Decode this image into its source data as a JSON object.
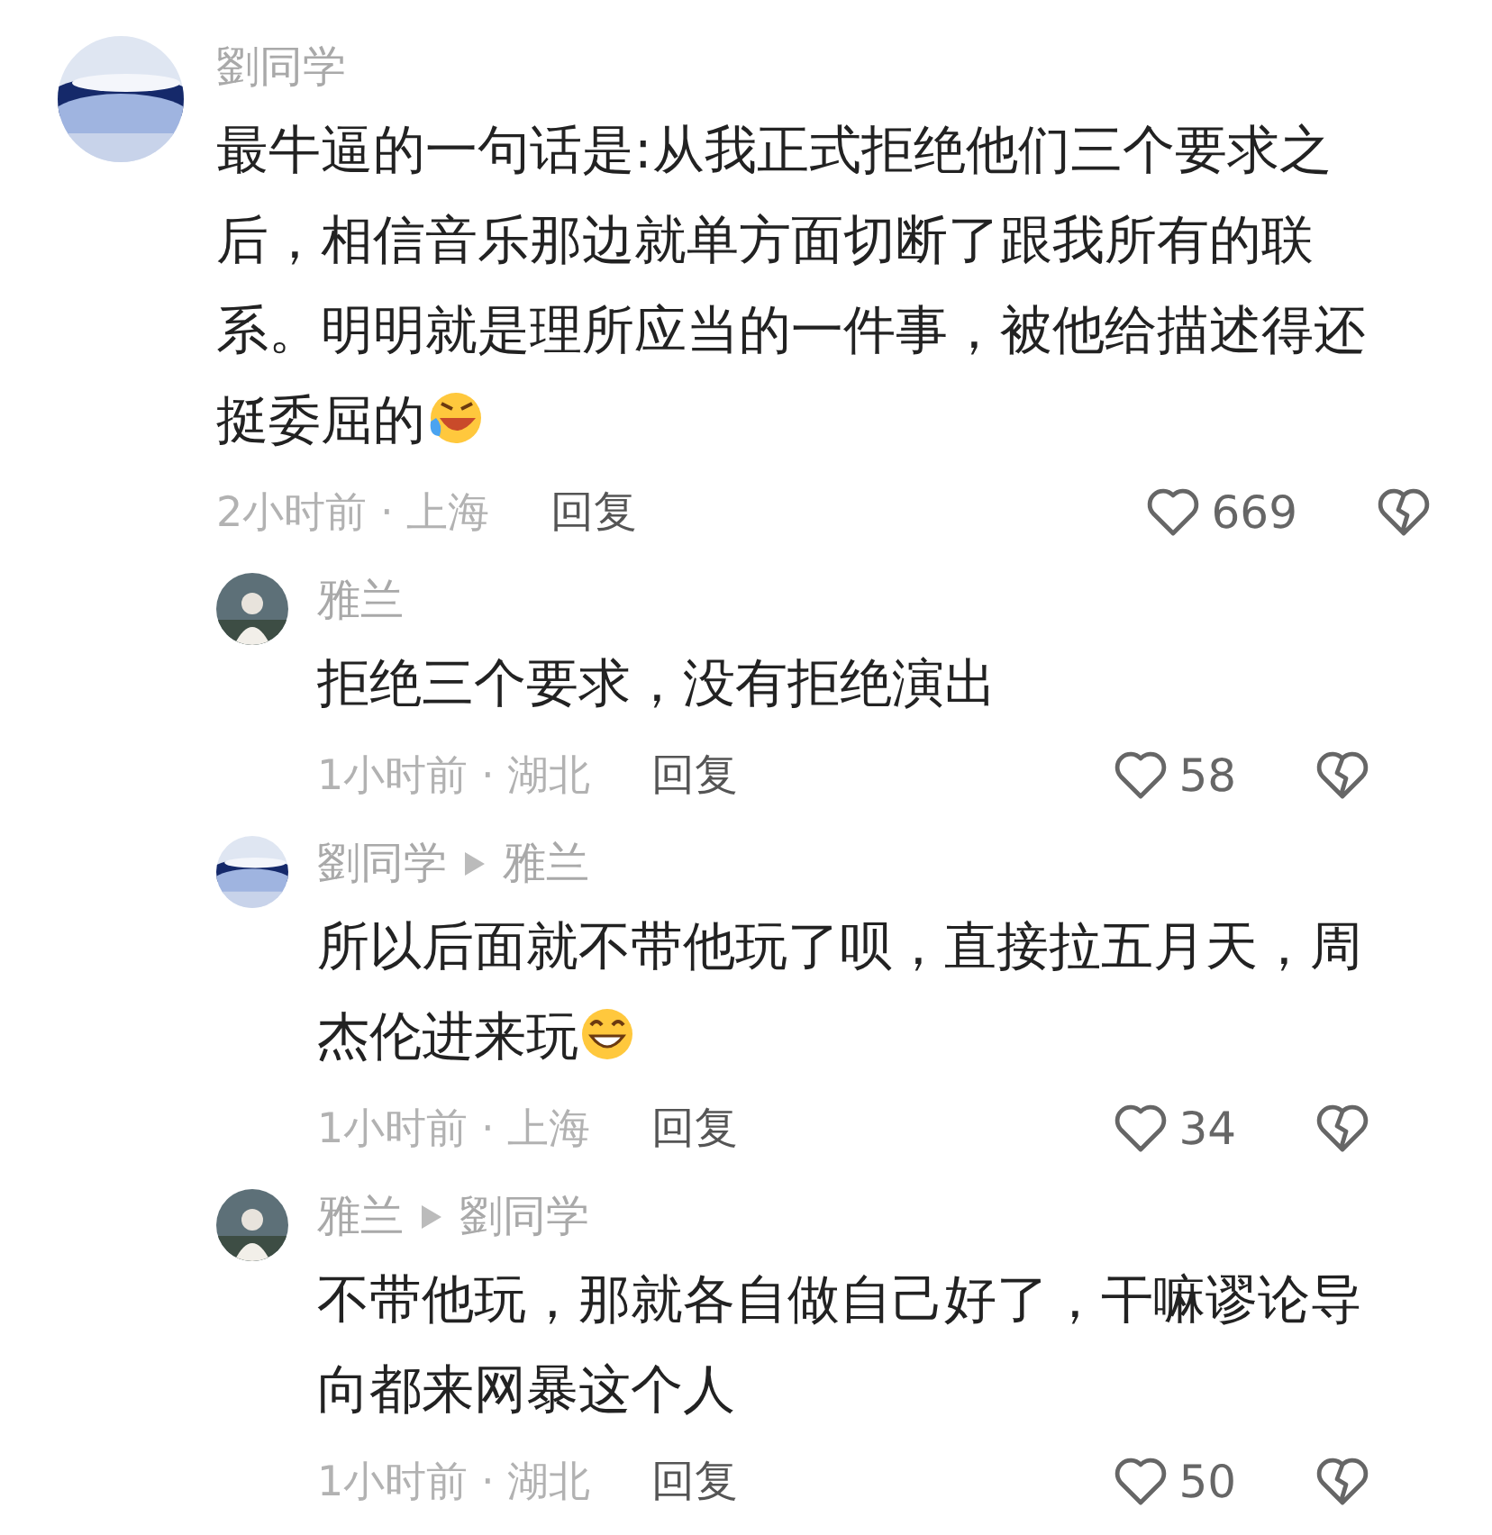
{
  "comments": [
    {
      "author": "劉同学",
      "avatar": {
        "kind": "swirl"
      },
      "text": "最牛逼的一句话是:从我正式拒绝他们三个要求之后，相信音乐那边就单方面切断了跟我所有的联系。明明就是理所应当的一件事，被他给描述得还挺委屈的",
      "emoji": {
        "kind": "laugh"
      },
      "meta": "2小时前 · 上海",
      "reply_label": "回复",
      "likes": "669",
      "replies": [
        {
          "author": "雅兰",
          "avatar": {
            "kind": "figure"
          },
          "text": "拒绝三个要求，没有拒绝演出",
          "meta": "1小时前 · 湖北",
          "reply_label": "回复",
          "likes": "58"
        },
        {
          "author": "劉同学",
          "reply_to": "雅兰",
          "avatar": {
            "kind": "swirl"
          },
          "text": "所以后面就不带他玩了呗，直接拉五月天，周杰伦进来玩",
          "emoji": {
            "kind": "grin"
          },
          "meta": "1小时前 · 上海",
          "reply_label": "回复",
          "likes": "34"
        },
        {
          "author": "雅兰",
          "reply_to": "劉同学",
          "avatar": {
            "kind": "figure"
          },
          "text": "不带他玩，那就各自做自己好了，干嘛谬论导向都来网暴这个人",
          "meta": "1小时前 · 湖北",
          "reply_label": "回复",
          "likes": "50"
        }
      ]
    }
  ]
}
